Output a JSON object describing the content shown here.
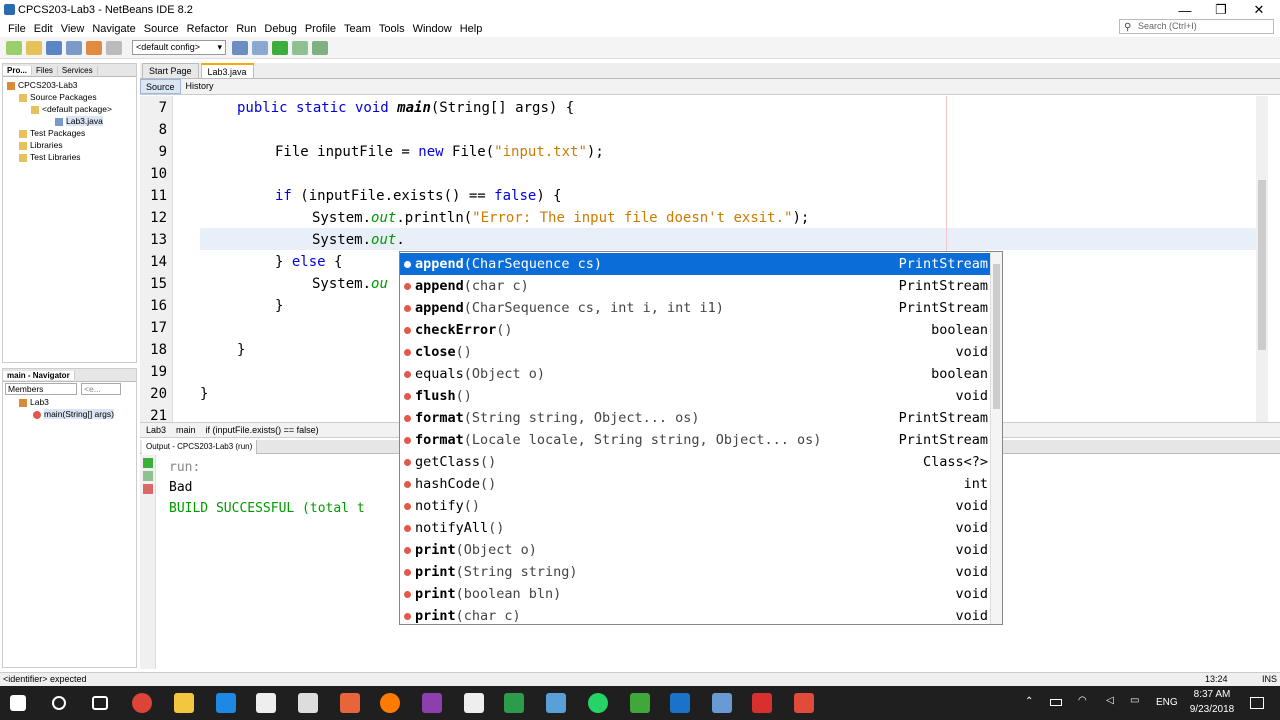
{
  "window": {
    "title": "CPCS203-Lab3 - NetBeans IDE 8.2"
  },
  "menu": [
    "File",
    "Edit",
    "View",
    "Navigate",
    "Source",
    "Refactor",
    "Run",
    "Debug",
    "Profile",
    "Team",
    "Tools",
    "Window",
    "Help"
  ],
  "search": {
    "placeholder": "Search (Ctrl+I)"
  },
  "toolbar": {
    "config": "<default config>"
  },
  "projects": {
    "tabs": [
      "Pro...",
      "Files",
      "Services"
    ],
    "tree": [
      "CPCS203-Lab3",
      "Source Packages",
      "<default package>",
      "Lab3.java",
      "Test Packages",
      "Libraries",
      "Test Libraries"
    ]
  },
  "navigator": {
    "title": "main - Navigator",
    "filter": "Members",
    "filter_placeholder": "<e...",
    "tree": [
      "Lab3",
      "main(String[] args)"
    ]
  },
  "editor": {
    "tabs": [
      "Start Page",
      "Lab3.java"
    ],
    "source_tabs": [
      "Source",
      "History"
    ],
    "line_numbers": [
      "7",
      "8",
      "9",
      "10",
      "11",
      "12",
      "13",
      "14",
      "15",
      "16",
      "17",
      "18",
      "19",
      "20",
      "21"
    ],
    "lines": {
      "l7": {
        "a": "public static void ",
        "b": "main",
        "c": "(String[] args) {"
      },
      "l9": {
        "a": "File inputFile = ",
        "b": "new",
        "c": " File(",
        "d": "\"input.txt\"",
        "e": ");"
      },
      "l11": {
        "a": "if",
        "b": " (inputFile.exists() == ",
        "c": "false",
        "d": ") {"
      },
      "l12": {
        "a": "System.",
        "b": "out",
        "c": ".println(",
        "d": "\"Error: The input file doesn't exsit.\"",
        "e": ");"
      },
      "l13": {
        "a": "System.",
        "b": "out",
        "c": "."
      },
      "l14": {
        "a": "} ",
        "b": "else",
        "c": " {"
      },
      "l15": {
        "a": "System.",
        "b": "ou"
      },
      "l16": "}",
      "l18": "}",
      "l20": "}"
    }
  },
  "breadcrumb": [
    "Lab3",
    "main",
    "if (inputFile.exists() == false)"
  ],
  "output": {
    "tab": "Output - CPCS203-Lab3 (run)",
    "lines": [
      "run:",
      "Bad",
      "BUILD SUCCESSFUL (total t"
    ]
  },
  "completion": [
    {
      "name": "append",
      "params": "(CharSequence cs)",
      "ret": "PrintStream",
      "bold": true
    },
    {
      "name": "append",
      "params": "(char c)",
      "ret": "PrintStream",
      "bold": true
    },
    {
      "name": "append",
      "params": "(CharSequence cs, int i, int i1)",
      "ret": "PrintStream",
      "bold": true
    },
    {
      "name": "checkError",
      "params": "()",
      "ret": "boolean",
      "bold": true
    },
    {
      "name": "close",
      "params": "()",
      "ret": "void",
      "bold": true
    },
    {
      "name": "equals",
      "params": "(Object o)",
      "ret": "boolean",
      "bold": false
    },
    {
      "name": "flush",
      "params": "()",
      "ret": "void",
      "bold": true
    },
    {
      "name": "format",
      "params": "(String string, Object... os)",
      "ret": "PrintStream",
      "bold": true
    },
    {
      "name": "format",
      "params": "(Locale locale, String string, Object... os)",
      "ret": "PrintStream",
      "bold": true
    },
    {
      "name": "getClass",
      "params": "()",
      "ret": "Class<?>",
      "bold": false
    },
    {
      "name": "hashCode",
      "params": "()",
      "ret": "int",
      "bold": false
    },
    {
      "name": "notify",
      "params": "()",
      "ret": "void",
      "bold": false
    },
    {
      "name": "notifyAll",
      "params": "()",
      "ret": "void",
      "bold": false
    },
    {
      "name": "print",
      "params": "(Object o)",
      "ret": "void",
      "bold": true
    },
    {
      "name": "print",
      "params": "(String string)",
      "ret": "void",
      "bold": true
    },
    {
      "name": "print",
      "params": "(boolean bln)",
      "ret": "void",
      "bold": true
    },
    {
      "name": "print",
      "params": "(char c)",
      "ret": "void",
      "bold": true
    }
  ],
  "status": {
    "message": "<identifier> expected",
    "position": "13:24",
    "mode": "INS"
  },
  "taskbar": {
    "time": "8:37 AM",
    "date": "9/23/2018",
    "lang": "ENG"
  }
}
